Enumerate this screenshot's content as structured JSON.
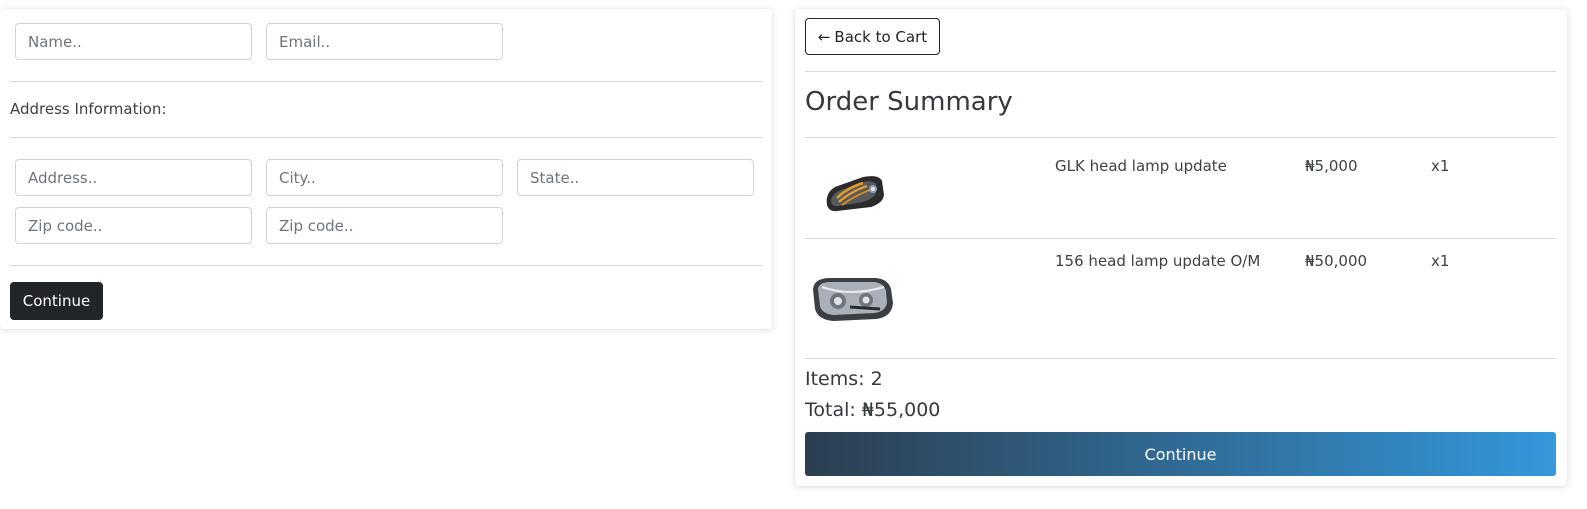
{
  "form": {
    "name_placeholder": "Name..",
    "email_placeholder": "Email..",
    "address_section_label": "Address Information:",
    "address_placeholder": "Address..",
    "city_placeholder": "City..",
    "state_placeholder": "State..",
    "zip_placeholder_1": "Zip code..",
    "zip_placeholder_2": "Zip code..",
    "continue_label": "Continue"
  },
  "summary": {
    "back_icon": "arrow-left-icon",
    "back_arrow": "←",
    "back_label": "Back to Cart",
    "title": "Order Summary",
    "items": [
      {
        "name": "GLK head lamp update",
        "price": "₦5,000",
        "qty": "x1",
        "image_icon": "headlamp-image"
      },
      {
        "name": "156 head lamp update O/M",
        "price": "₦50,000",
        "qty": "x1",
        "image_icon": "headlamp-image"
      }
    ],
    "items_count_text": "Items: 2",
    "total_text": "Total: ₦55,000",
    "continue_label": "Continue"
  },
  "colors": {
    "dark_button": "#212529",
    "gradient_start": "#2c3e50",
    "gradient_end": "#3498db"
  }
}
